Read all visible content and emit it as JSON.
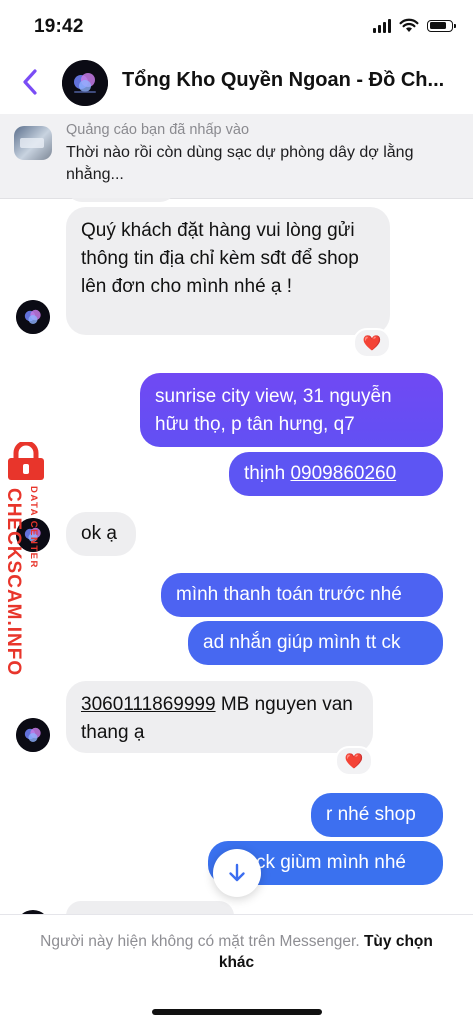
{
  "status": {
    "time": "19:42"
  },
  "header": {
    "title": "Tổng Kho Quyền Ngoan - Đồ Ch...",
    "back_icon": "chevron-left-icon"
  },
  "ad": {
    "label": "Quảng cáo bạn đã nhấp vào",
    "text": "Thời nào rồi còn dùng sạc dự phòng dây dợ lằng nhằng..."
  },
  "messages": {
    "m1": "Quý khách  đặt hàng vui lòng gửi thông tin địa chỉ kèm sđt để shop lên đơn cho mình nhé ạ !",
    "m2": "sunrise city view, 31 nguyễn hữu thọ, p tân hưng, q7",
    "m3_prefix": "thịnh ",
    "m3_phone": "0909860260",
    "m4": "ok ạ",
    "m5": "mình thanh toán trước nhé",
    "m6": "ad nhắn giúp mình tt ck",
    "m7_account": "3060111869999",
    "m7_rest": " MB nguyen van thang ạ",
    "m8": "r nhé shop",
    "m9": "ck giùm mình nhé"
  },
  "reactions": {
    "r1": "❤️",
    "r2": "❤️"
  },
  "watermark": {
    "main": "CHECKSCAM.INFO",
    "sub": "DATA CENTER"
  },
  "footer": {
    "text": "Người này hiện không có mặt trên Messenger. ",
    "link": "Tùy chọn khác"
  },
  "colors": {
    "accent": "#7a4cf5",
    "bubble_out_top": "#6a4bf2",
    "bubble_out_bottom": "#3f6ef0",
    "bubble_in": "#eeeef0",
    "watermark": "#e8352b"
  }
}
